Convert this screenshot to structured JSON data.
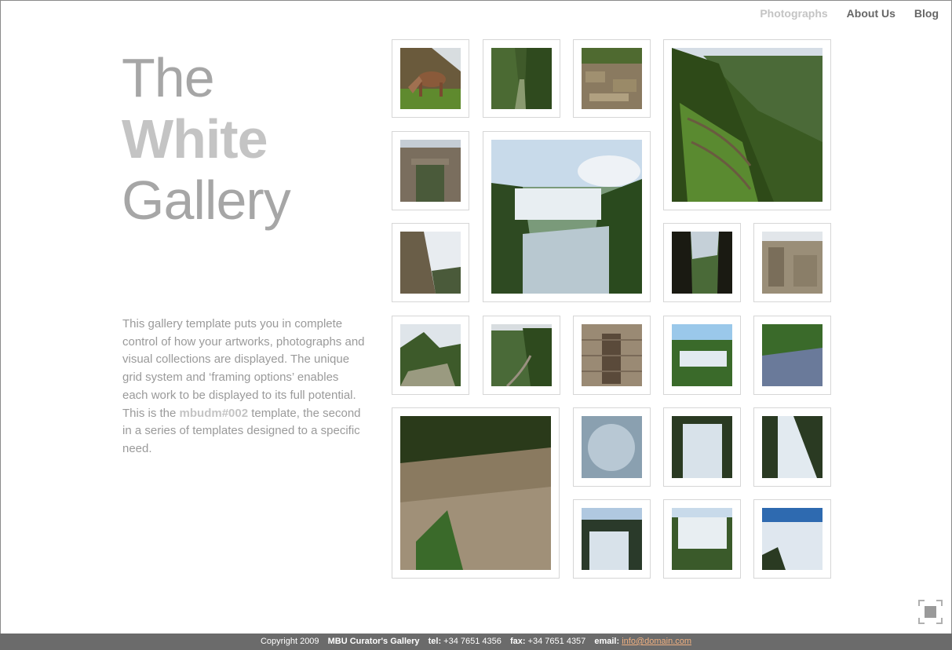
{
  "nav": {
    "photographs": "Photographs",
    "about": "About Us",
    "blog": "Blog"
  },
  "title": {
    "line1": "The",
    "line2": "White",
    "line3": "Gallery"
  },
  "description": {
    "before": "This gallery template puts you in complete control of how your artworks, photographs and visual collections are displayed. The unique grid system and ‘framing options’ enables each work to be displayed to its full potential. This is the ",
    "tag": "mbudm#002",
    "after": " template, the second in a series of templates designed to a specific need."
  },
  "footer": {
    "copyright": "Copyright 2009",
    "gallery": "MBU Curator's Gallery",
    "tel_label": "tel:",
    "tel": "+34 7651 4356",
    "fax_label": "fax:",
    "fax": "+34 7651 4357",
    "email_label": "email:",
    "email": "info@domain.com"
  },
  "colors": {
    "nav_active": "#c4c4c4",
    "nav": "#666666",
    "title": "#a6a6a6",
    "footer_bg": "#6b6b6b",
    "email_link": "#f0b080"
  },
  "photos": [
    {
      "subject": "llama-grazing-on-terrace"
    },
    {
      "subject": "green-mountain-valley"
    },
    {
      "subject": "stone-ruins"
    },
    {
      "subject": "inca-terraces-on-mountain"
    },
    {
      "subject": "stone-doorway"
    },
    {
      "subject": "waterfalls-canyon"
    },
    {
      "subject": "rocky-cliff"
    },
    {
      "subject": "dark-cave-view"
    },
    {
      "subject": "stone-steps-ruins"
    },
    {
      "subject": "machu-picchu-peak"
    },
    {
      "subject": "valley-road"
    },
    {
      "subject": "stone-window"
    },
    {
      "subject": "waterfall-jungle"
    },
    {
      "subject": "river-rapids-forest"
    },
    {
      "subject": "rushing-river"
    },
    {
      "subject": "misty-waterfall-spray"
    },
    {
      "subject": "tall-waterfall"
    },
    {
      "subject": "waterfall-cascade"
    },
    {
      "subject": "waterfall-rocks"
    },
    {
      "subject": "wide-waterfalls"
    },
    {
      "subject": "waterfall-blue-sky"
    }
  ]
}
